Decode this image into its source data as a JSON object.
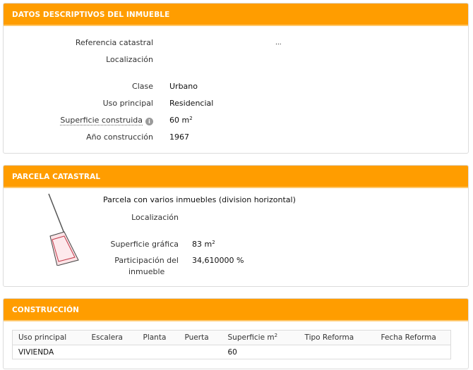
{
  "descriptivos": {
    "title": "DATOS DESCRIPTIVOS DEL INMUEBLE",
    "referencia_label": "Referencia catastral",
    "referencia_value": "...",
    "localizacion_label": "Localización",
    "clase_label": "Clase",
    "clase_value": "Urbano",
    "uso_label": "Uso principal",
    "uso_value": "Residencial",
    "superficie_label": "Superficie construida",
    "superficie_value": "60 m",
    "superficie_unit_exp": "2",
    "ano_label": "Año construcción",
    "ano_value": "1967",
    "info_icon": "info-icon"
  },
  "parcela": {
    "title": "PARCELA CATASTRAL",
    "descripcion": "Parcela con varios inmuebles (division horizontal)",
    "localizacion_label": "Localización",
    "superficie_label": "Superficie gráfica",
    "superficie_value": "83 m",
    "superficie_unit_exp": "2",
    "participacion_label_1": "Participación del",
    "participacion_label_2": "inmueble",
    "participacion_value": "34,610000 %"
  },
  "construccion": {
    "title": "CONSTRUCCIÓN",
    "columns": [
      "Uso principal",
      "Escalera",
      "Planta",
      "Puerta",
      "Superficie m",
      "Tipo Reforma",
      "Fecha Reforma"
    ],
    "superficie_col_exp": "2",
    "rows": [
      [
        "VIVIENDA",
        "",
        "",
        "",
        "60",
        "",
        ""
      ]
    ]
  }
}
